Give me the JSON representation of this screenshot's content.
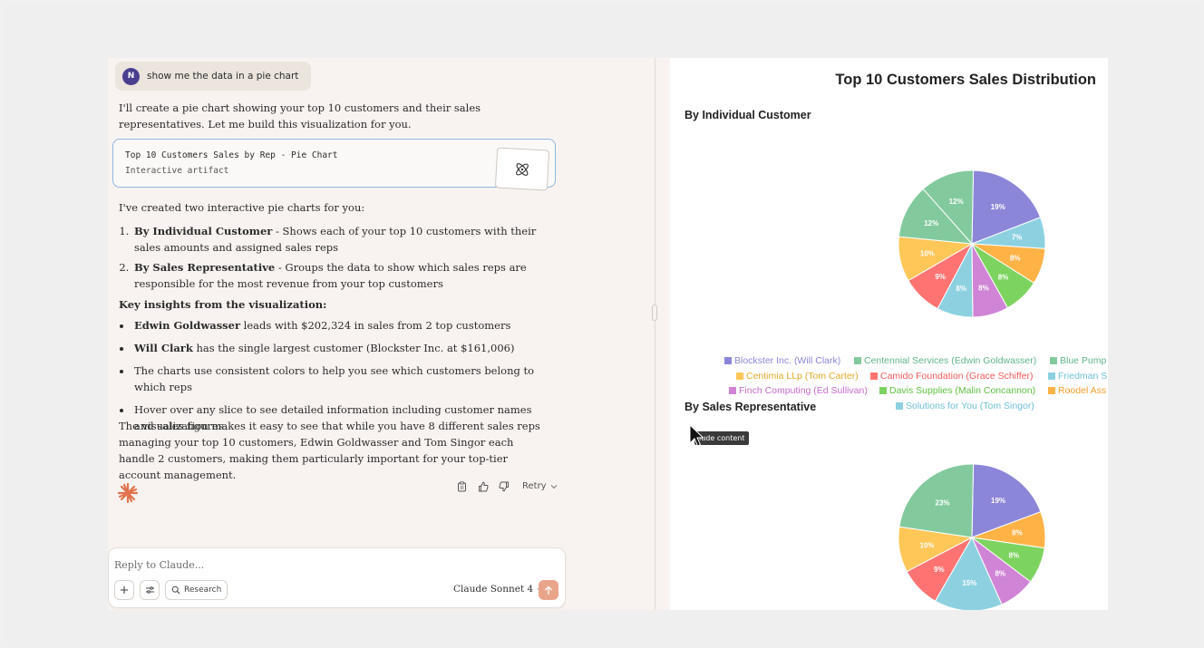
{
  "user_message": {
    "avatar_initial": "N",
    "text": "show me the data in a pie chart"
  },
  "intro": "I'll create a pie chart showing your top 10 customers and their sales representatives. Let me build this visualization for you.",
  "artifact_card": {
    "title": "Top 10 Customers Sales by Rep - Pie Chart",
    "subtitle": "Interactive artifact",
    "thumb_icon": "atom-icon"
  },
  "created_line": "I've created two interactive pie charts for you:",
  "list": [
    {
      "bold": "By Individual Customer",
      "text": " - Shows each of your top 10 customers with their sales amounts and assigned sales reps"
    },
    {
      "bold": "By Sales Representative",
      "text": " - Groups the data to show which sales reps are responsible for the most revenue from your top customers"
    }
  ],
  "insights_heading": "Key insights from the visualization:",
  "bullets": [
    {
      "bold": "Edwin Goldwasser",
      "text": " leads with $202,324 in sales from 2 top customers"
    },
    {
      "bold": "Will Clark",
      "text": " has the single largest customer (Blockster Inc. at $161,006)"
    },
    {
      "bold": "",
      "text": "The charts use consistent colors to help you see which customers belong to which reps"
    },
    {
      "bold": "",
      "text": "Hover over any slice to see detailed information including customer names and sales figures"
    }
  ],
  "summary": "The visualization makes it easy to see that while you have 8 different sales reps managing your top 10 customers, Edwin Goldwasser and Tom Singor each handle 2 customers, making them particularly important for your top-tier account management.",
  "actions": {
    "retry_label": "Retry"
  },
  "composer": {
    "placeholder": "Reply to Claude...",
    "research_label": "Research",
    "model_label": "Claude Sonnet 4"
  },
  "panel": {
    "title": "Top 10 Customers Sales Distribution",
    "section1": "By Individual Customer",
    "section2": "By Sales Representative",
    "tooltip": "lude content"
  },
  "legend": [
    {
      "label": "Blockster Inc. (Will Clark)",
      "color": "#8c86d9"
    },
    {
      "label": "Centennial Services (Edwin Goldwasser)",
      "color": "#82ca9d"
    },
    {
      "label": "Blue Pump",
      "color": "#82ca9d"
    },
    {
      "label": "Centimia LLp (Tom Carter)",
      "color": "#ffc658"
    },
    {
      "label": "Camido Foundation (Grace Schiffer)",
      "color": "#ff7373"
    },
    {
      "label": "Friedman S",
      "color": "#8dd1e1"
    },
    {
      "label": "Finch Computing (Ed Sullivan)",
      "color": "#d084d6"
    },
    {
      "label": "Davis Supplies (Malin Concannon)",
      "color": "#7dd35f"
    },
    {
      "label": "Roodel Ass",
      "color": "#ffb347"
    },
    {
      "label": "Solutions for You (Tom Singor)",
      "color": "#8dd1e1"
    }
  ],
  "chart_data": [
    {
      "type": "pie",
      "title": "By Individual Customer",
      "labels": [
        "Blockster Inc. (Will Clark)",
        "Solutions for You (Tom Singor)",
        "Roodel Ass",
        "Davis Supplies (Malin Concannon)",
        "Finch Computing (Ed Sullivan)",
        "Friedman S",
        "Camido Foundation (Grace Schiffer)",
        "Centimia LLp (Tom Carter)",
        "Blue Pump",
        "Centennial Services (Edwin Goldwasser)"
      ],
      "values": [
        19,
        7,
        8,
        8,
        8,
        8,
        9,
        10,
        12,
        12
      ],
      "colors": [
        "#8c86d9",
        "#8dd1e1",
        "#ffb347",
        "#7dd35f",
        "#d084d6",
        "#8dd1e1",
        "#ff7373",
        "#ffc658",
        "#82ca9d",
        "#82ca9d"
      ],
      "data_labels": [
        "19%",
        "7%",
        "8%",
        "8%",
        "8%",
        "8%",
        "9%",
        "10%",
        "12%",
        "12%"
      ]
    },
    {
      "type": "pie",
      "title": "By Sales Representative",
      "values": [
        19,
        8,
        8,
        8,
        15,
        9,
        10,
        23
      ],
      "colors": [
        "#8c86d9",
        "#ffb347",
        "#7dd35f",
        "#d084d6",
        "#8dd1e1",
        "#ff7373",
        "#ffc658",
        "#82ca9d"
      ],
      "data_labels": [
        "19%",
        "8%",
        "8%",
        "8%",
        "15%",
        "9%",
        "10%",
        "23%"
      ]
    }
  ]
}
